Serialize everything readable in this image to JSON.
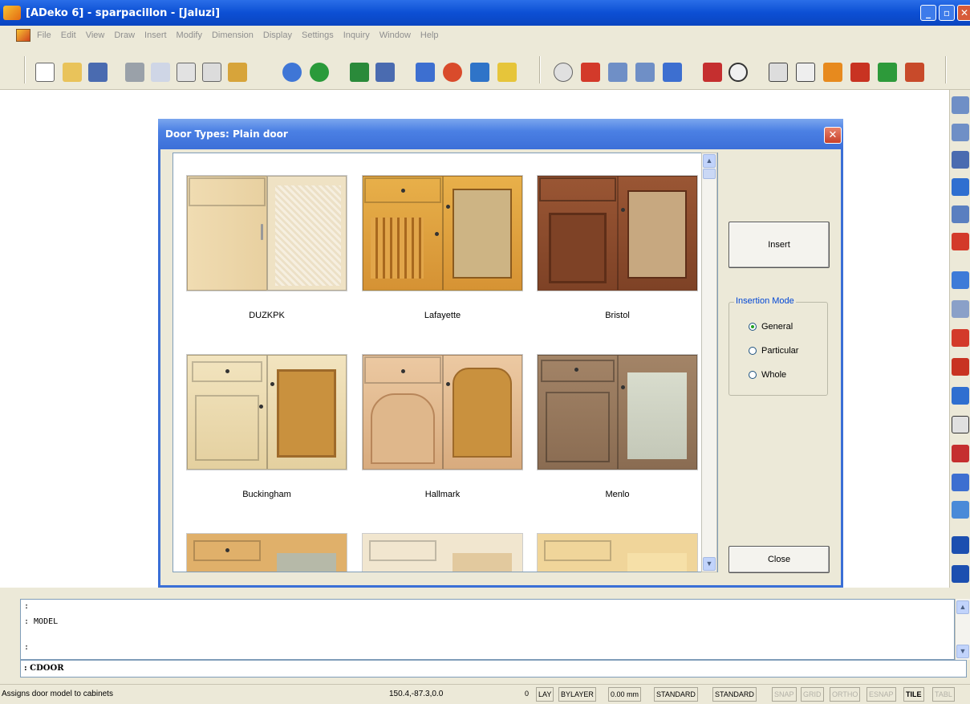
{
  "window": {
    "title": "[ADeko 6] - sparpacillon - [Jaluzi]"
  },
  "menu": [
    "File",
    "Edit",
    "View",
    "Draw",
    "Insert",
    "Modify",
    "Dimension",
    "Display",
    "Settings",
    "Inquiry",
    "Window",
    "Help"
  ],
  "dialog": {
    "title": "Door Types: Plain door",
    "items": [
      {
        "name": "DUZKPK",
        "style": "plain"
      },
      {
        "name": "Lafayette",
        "style": "pine"
      },
      {
        "name": "Bristol",
        "style": "walnut"
      },
      {
        "name": "Buckingham",
        "style": "cream"
      },
      {
        "name": "Hallmark",
        "style": "birch"
      },
      {
        "name": "Menlo",
        "style": "ash"
      }
    ],
    "insert_label": "Insert",
    "close_label": "Close",
    "insertion_mode": {
      "label": "Insertion Mode",
      "options": [
        "General",
        "Particular",
        "Whole"
      ],
      "selected": "General"
    }
  },
  "command": {
    "lines": [
      ":",
      ": MODEL",
      "",
      ":"
    ],
    "input": ": CDOOR"
  },
  "status": {
    "hint": "Assigns door model to cabinets",
    "coords": "150.4,-87.3,0.0",
    "cells": [
      "0",
      "LAY",
      "BYLAYER",
      "0.00 mm",
      "STANDARD",
      "STANDARD",
      "SNAP",
      "GRID",
      "ORTHO",
      "ESNAP",
      "TILE",
      "TABL"
    ]
  },
  "colors": {
    "accent": "#0c4fd4",
    "selection": "#21a121"
  }
}
